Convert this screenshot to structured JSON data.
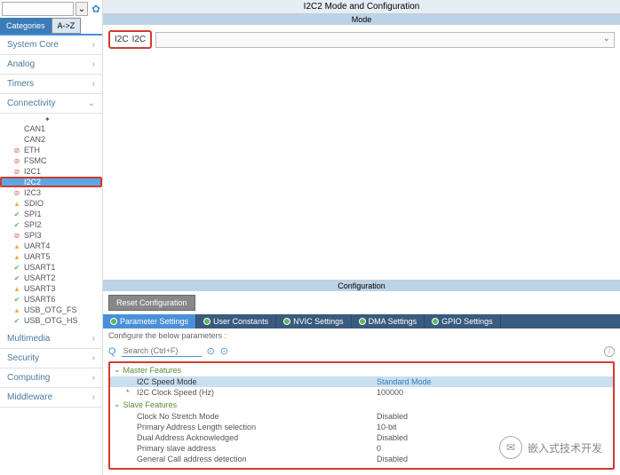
{
  "search": {
    "placeholder": ""
  },
  "sidebar_tabs": {
    "categories": "Categories",
    "az": "A->Z"
  },
  "categories": [
    {
      "label": "System Core",
      "expanded": false
    },
    {
      "label": "Analog",
      "expanded": false
    },
    {
      "label": "Timers",
      "expanded": false
    },
    {
      "label": "Connectivity",
      "expanded": true
    },
    {
      "label": "Multimedia",
      "expanded": false
    },
    {
      "label": "Security",
      "expanded": false
    },
    {
      "label": "Computing",
      "expanded": false
    },
    {
      "label": "Middleware",
      "expanded": false
    }
  ],
  "peripherals": [
    {
      "name": "CAN1",
      "status": "none"
    },
    {
      "name": "CAN2",
      "status": "none"
    },
    {
      "name": "ETH",
      "status": "disabled"
    },
    {
      "name": "FSMC",
      "status": "disabled"
    },
    {
      "name": "I2C1",
      "status": "disabled"
    },
    {
      "name": "I2C2",
      "status": "selected"
    },
    {
      "name": "I2C3",
      "status": "disabled"
    },
    {
      "name": "SDIO",
      "status": "warn"
    },
    {
      "name": "SPI1",
      "status": "ok"
    },
    {
      "name": "SPI2",
      "status": "ok"
    },
    {
      "name": "SPI3",
      "status": "disabled"
    },
    {
      "name": "UART4",
      "status": "warn"
    },
    {
      "name": "UART5",
      "status": "warn"
    },
    {
      "name": "USART1",
      "status": "ok"
    },
    {
      "name": "USART2",
      "status": "ok"
    },
    {
      "name": "USART3",
      "status": "warn"
    },
    {
      "name": "USART6",
      "status": "ok"
    },
    {
      "name": "USB_OTG_FS",
      "status": "warn"
    },
    {
      "name": "USB_OTG_HS",
      "status": "ok"
    }
  ],
  "title": "I2C2 Mode and Configuration",
  "mode": {
    "header": "Mode",
    "label": "I2C",
    "value": "I2C"
  },
  "config": {
    "header": "Configuration",
    "reset_btn": "Reset Configuration",
    "tabs": [
      "Parameter Settings",
      "User Constants",
      "NVIC Settings",
      "DMA Settings",
      "GPIO Settings"
    ],
    "hint": "Configure the below parameters :",
    "search_placeholder": "Search (Ctrl+F)"
  },
  "params": {
    "master_group": "Master Features",
    "slave_group": "Slave Features",
    "rows": [
      {
        "label": "I2C Speed Mode",
        "value": "Standard Mode",
        "selected": true,
        "indent": false
      },
      {
        "label": "I2C Clock Speed (Hz)",
        "value": "100000",
        "selected": false,
        "indent": true
      }
    ],
    "slave_rows": [
      {
        "label": "Clock No Stretch Mode",
        "value": "Disabled"
      },
      {
        "label": "Primary Address Length selection",
        "value": "10-bit"
      },
      {
        "label": "Dual Address Acknowledged",
        "value": "Disabled"
      },
      {
        "label": "Primary slave address",
        "value": "0"
      },
      {
        "label": "General Call address detection",
        "value": "Disabled"
      }
    ]
  },
  "watermark": "嵌入式技术开发"
}
